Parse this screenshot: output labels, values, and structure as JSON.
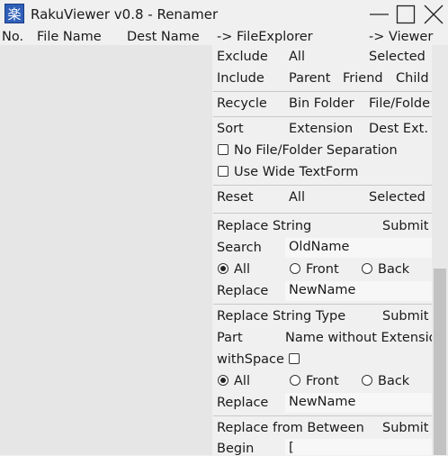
{
  "window": {
    "title": "RakuViewer v0.8 - Renamer",
    "icon": "app-icon",
    "icon_glyph": "楽"
  },
  "file_list": {
    "columns": [
      "No.",
      "File Name",
      "Dest Name"
    ]
  },
  "panel": {
    "to_explorer": "-> FileExplorer",
    "to_viewer": "-> Viewer",
    "exclude": {
      "label": "Exclude",
      "all": "All",
      "selected": "Selected"
    },
    "include": {
      "label": "Include",
      "parent": "Parent",
      "friend": "Friend",
      "child": "Child"
    },
    "recycle": {
      "label": "Recycle",
      "bin_folder": "Bin Folder",
      "file_folder": "File/Folde"
    },
    "sort": {
      "label": "Sort",
      "extension": "Extension",
      "dest_ext": "Dest Ext.",
      "no_separation": "No File/Folder Separation",
      "wide_textform": "Use Wide TextForm"
    },
    "reset": {
      "label": "Reset",
      "all": "All",
      "selected": "Selected"
    },
    "replace_string": {
      "title": "Replace String",
      "submit": "Submit",
      "search_label": "Search",
      "search_value": "OldName",
      "opt_all": "All",
      "opt_front": "Front",
      "opt_back": "Back",
      "replace_label": "Replace",
      "replace_value": "NewName"
    },
    "replace_type": {
      "title": "Replace String Type",
      "submit": "Submit",
      "part_label": "Part",
      "part_value": "Name without Extensio",
      "with_space": "withSpace",
      "opt_all": "All",
      "opt_front": "Front",
      "opt_back": "Back",
      "replace_label": "Replace",
      "replace_value": "NewName"
    },
    "replace_between": {
      "title": "Replace from Between",
      "submit": "Submit",
      "begin_label": "Begin",
      "begin_value": "["
    }
  }
}
